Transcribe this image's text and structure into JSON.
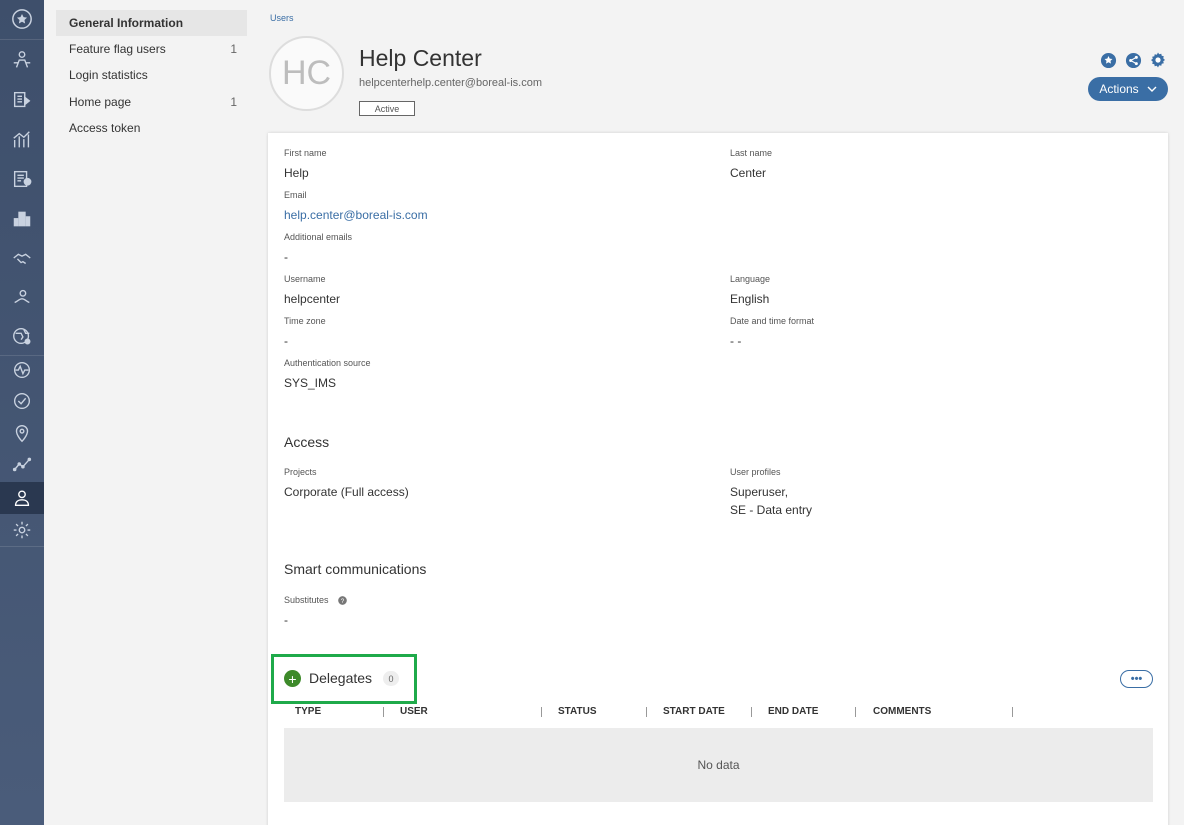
{
  "sidebar": {
    "items": [
      {
        "label": "General Information",
        "count": ""
      },
      {
        "label": "Feature flag users",
        "count": "1"
      },
      {
        "label": "Login statistics",
        "count": ""
      },
      {
        "label": "Home page",
        "count": "1"
      },
      {
        "label": "Access token",
        "count": ""
      }
    ]
  },
  "breadcrumb": "Users",
  "user": {
    "initials": "HC",
    "name": "Help Center",
    "email": "helpcenterhelp.center@boreal-is.com",
    "status": "Active"
  },
  "header": {
    "actions_label": "Actions",
    "accent_color": "#3a6ea5"
  },
  "fields": {
    "first_name": {
      "label": "First name",
      "value": "Help"
    },
    "last_name": {
      "label": "Last name",
      "value": "Center"
    },
    "email": {
      "label": "Email",
      "value": "help.center@boreal-is.com"
    },
    "additional_emails": {
      "label": "Additional emails",
      "value": "-"
    },
    "username": {
      "label": "Username",
      "value": "helpcenter"
    },
    "language": {
      "label": "Language",
      "value": "English"
    },
    "time_zone": {
      "label": "Time zone",
      "value": "-"
    },
    "date_format": {
      "label": "Date and time format",
      "value": "- -"
    },
    "auth_source": {
      "label": "Authentication source",
      "value": "SYS_IMS"
    }
  },
  "access": {
    "title": "Access",
    "projects_label": "Projects",
    "projects_value": "Corporate (Full access)",
    "profiles_label": "User profiles",
    "profiles_line1": "Superuser,",
    "profiles_line2": "SE - Data entry"
  },
  "smart": {
    "title": "Smart communications",
    "substitutes_label": "Substitutes",
    "substitutes_value": "-"
  },
  "delegates": {
    "title": "Delegates",
    "count": "0",
    "more": "•••",
    "columns": [
      "TYPE",
      "USER",
      "STATUS",
      "START DATE",
      "END DATE",
      "COMMENTS"
    ],
    "empty_text": "No data",
    "highlight_color": "#1faa4a"
  }
}
